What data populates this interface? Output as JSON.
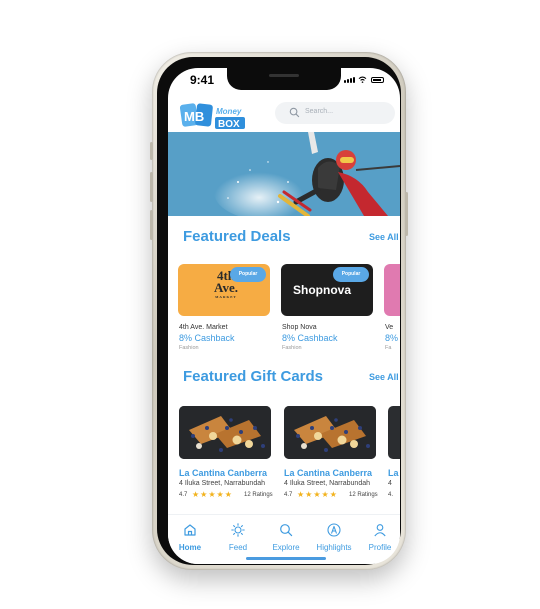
{
  "status_bar": {
    "time": "9:41"
  },
  "logo": {
    "mark": "MB",
    "word_top": "Money",
    "word_bottom": "BOX"
  },
  "search": {
    "placeholder": "Search..."
  },
  "featured_deals": {
    "title": "Featured Deals",
    "see_all": "See All",
    "items": [
      {
        "brand_line1": "4th",
        "brand_line2": "Ave.",
        "brand_sub": "MARKET",
        "badge": "Popular",
        "name": "4th Ave. Market",
        "cashback": "8% Cashback",
        "category": "Fashion"
      },
      {
        "brand_text": "Shopnova",
        "badge": "Popular",
        "name": "Shop Nova",
        "cashback": "8% Cashback",
        "category": "Fashion"
      },
      {
        "name": "Ve",
        "cashback": "8%",
        "category": "Fa"
      }
    ]
  },
  "featured_gift_cards": {
    "title": "Featured Gift Cards",
    "see_all": "See All",
    "items": [
      {
        "name": "La Cantina Canberra",
        "address": "4 Iluka Street, Narrabundah",
        "rating": "4.7",
        "stars": "★★★★★",
        "ratings_count": "12 Ratings"
      },
      {
        "name": "La Cantina Canberra",
        "address": "4 Iluka Street, Narrabundah",
        "rating": "4.7",
        "stars": "★★★★★",
        "ratings_count": "12 Ratings"
      },
      {
        "name": "La",
        "address": "4",
        "rating": "4."
      }
    ]
  },
  "nav": {
    "items": [
      {
        "label": "Home",
        "icon": "home-icon"
      },
      {
        "label": "Feed",
        "icon": "sun-icon"
      },
      {
        "label": "Explore",
        "icon": "search-icon"
      },
      {
        "label": "Highlights",
        "icon": "highlights-icon"
      },
      {
        "label": "Profile",
        "icon": "profile-icon"
      }
    ]
  },
  "colors": {
    "accent": "#3e9be0",
    "deal1_bg": "#f6ac44",
    "deal2_bg": "#1e1e1e",
    "deal3_bg": "#e07ab0"
  }
}
